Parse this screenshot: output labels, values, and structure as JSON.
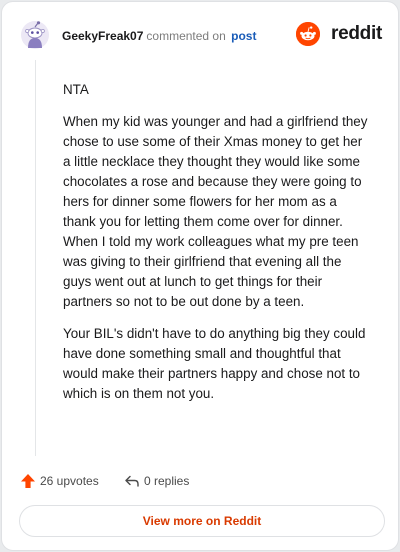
{
  "header": {
    "username": "GeekyFreak07",
    "commented_text": "commented on",
    "post_link": "post",
    "brand": "reddit"
  },
  "comment": {
    "paragraphs": [
      "NTA",
      "When my kid was younger and had a girlfriend they chose to use some of their Xmas money to get her a little necklace they thought they would like some chocolates a rose and because they were going to hers for dinner some flowers for her mom as a thank you for letting them come over for dinner. When I told my work colleagues what my pre teen was giving to their girlfriend that evening all the guys went out at lunch to get things for their partners so not to be out done by a teen.",
      "Your BIL's didn't have to do anything big they could have done something small and thoughtful that would make their partners happy and chose not to which is on them not you."
    ]
  },
  "actions": {
    "upvotes": "26 upvotes",
    "replies": "0 replies"
  },
  "view_more": "View more on Reddit",
  "colors": {
    "accent": "#ff4500",
    "link": "#1a5cb8",
    "button_text": "#d93a00"
  },
  "icons": [
    "avatar-snoo",
    "reddit-logo-icon",
    "upvote-arrow-icon",
    "reply-arrow-icon"
  ]
}
